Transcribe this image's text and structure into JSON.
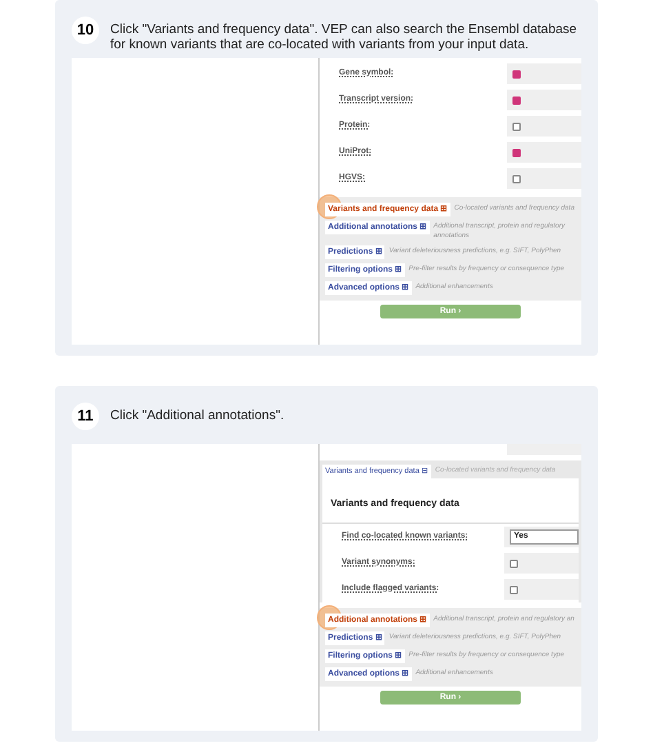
{
  "steps": [
    {
      "number": "10",
      "instruction": "Click \"Variants and frequency data\". VEP can also search the Ensembl database for known variants that are co-located with variants from your input data.",
      "rows": [
        {
          "kind": "checkbox",
          "label": "Gene symbol:",
          "checked": true
        },
        {
          "kind": "checkbox",
          "label": "Transcript version:",
          "checked": true
        },
        {
          "kind": "checkbox",
          "label": "Protein:",
          "checked": false
        },
        {
          "kind": "checkbox",
          "label": "UniProt:",
          "checked": true
        },
        {
          "kind": "checkbox",
          "label": "HGVS:",
          "checked": false
        }
      ],
      "options": [
        {
          "label": "Variants and frequency data",
          "toggle": "⊞",
          "description": "Co-located variants and frequency data",
          "highlighted": true
        },
        {
          "label": "Additional annotations",
          "toggle": "⊞",
          "description": "Additional transcript, protein and regulatory annotations",
          "highlighted": false
        },
        {
          "label": "Predictions",
          "toggle": "⊞",
          "description": "Variant deleteriousness predictions, e.g. SIFT, PolyPhen",
          "highlighted": false
        },
        {
          "label": "Filtering options",
          "toggle": "⊞",
          "description": "Pre-filter results by frequency or consequence type",
          "highlighted": false
        },
        {
          "label": "Advanced options",
          "toggle": "⊞",
          "description": "Additional enhancements",
          "highlighted": false
        }
      ],
      "run_button": "Run ›"
    },
    {
      "number": "11",
      "instruction": "Click \"Additional annotations\".",
      "section_tab": {
        "label": "Variants and frequency data",
        "toggle": "⊟",
        "description": "Co-located variants and frequency data"
      },
      "section_heading": "Variants and frequency data",
      "rows": [
        {
          "kind": "select",
          "label": "Find co-located known variants:",
          "value": "Yes"
        },
        {
          "kind": "checkbox",
          "label": "Variant synonyms:",
          "checked": false
        },
        {
          "kind": "checkbox",
          "label": "Include flagged variants:",
          "checked": false
        }
      ],
      "options": [
        {
          "label": "Additional annotations",
          "toggle": "⊞",
          "description": "Additional transcript, protein and regulatory an",
          "highlighted": true
        },
        {
          "label": "Predictions",
          "toggle": "⊞",
          "description": "Variant deleteriousness predictions, e.g. SIFT, PolyPhen",
          "highlighted": false
        },
        {
          "label": "Filtering options",
          "toggle": "⊞",
          "description": "Pre-filter results by frequency or consequence type",
          "highlighted": false
        },
        {
          "label": "Advanced options",
          "toggle": "⊞",
          "description": "Additional enhancements",
          "highlighted": false
        }
      ],
      "run_button": "Run ›"
    }
  ]
}
